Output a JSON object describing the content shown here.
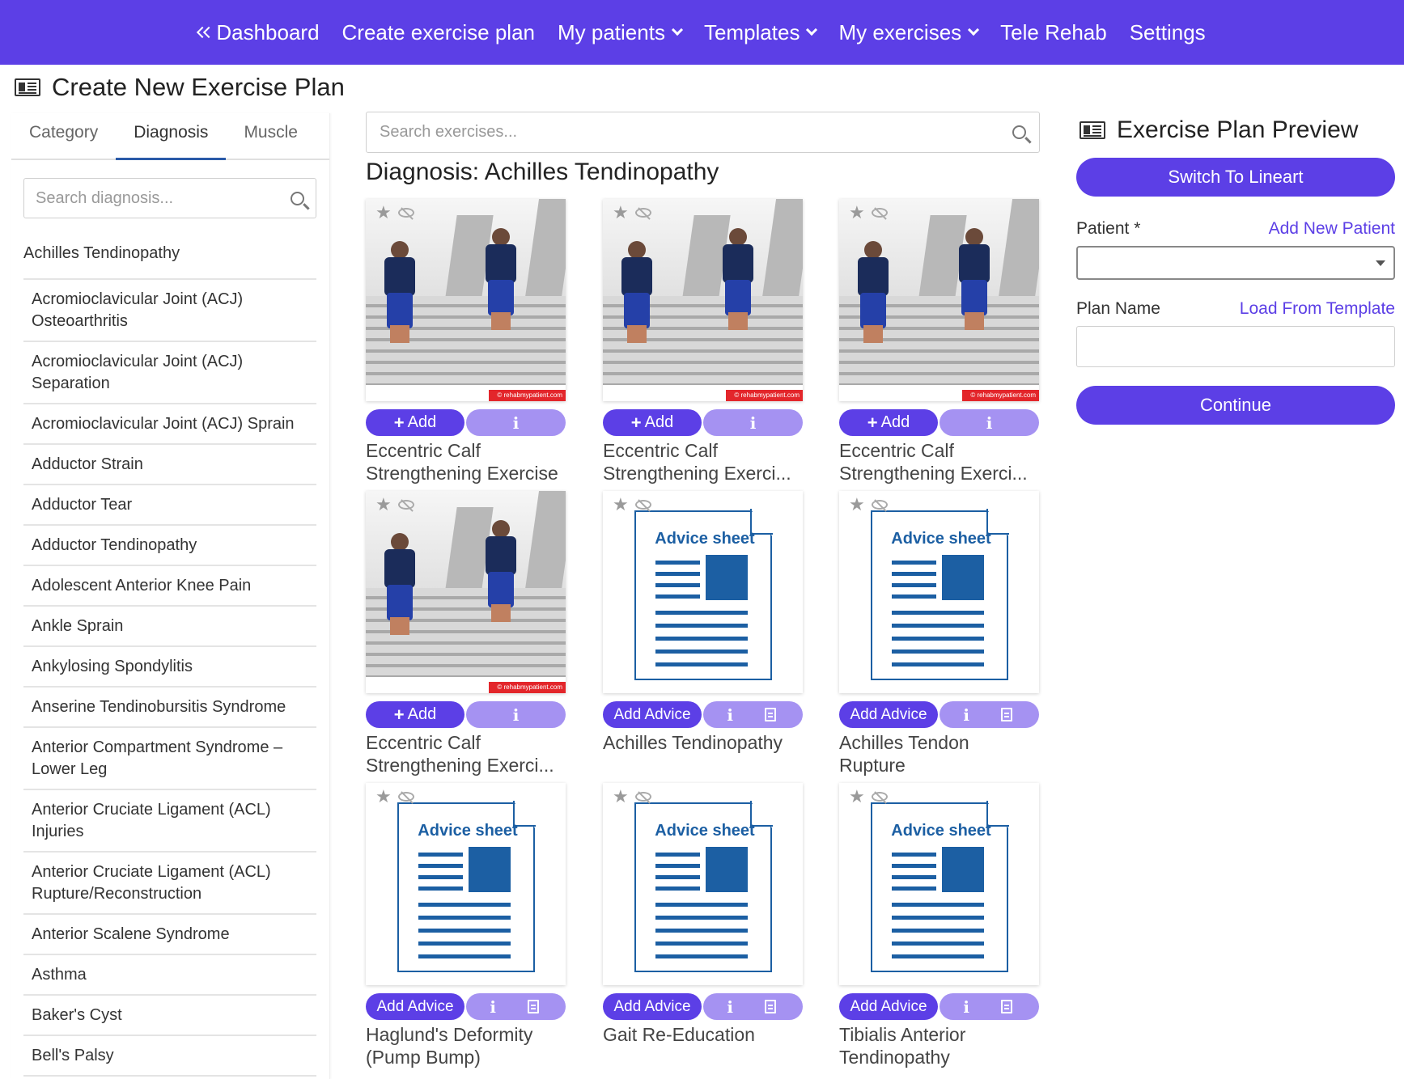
{
  "nav": {
    "dashboard": "Dashboard",
    "create_plan": "Create exercise plan",
    "my_patients": "My patients",
    "templates": "Templates",
    "my_exercises": "My exercises",
    "tele_rehab": "Tele Rehab",
    "settings": "Settings"
  },
  "page_title": "Create New Exercise Plan",
  "left": {
    "tabs": [
      "Category",
      "Diagnosis",
      "Muscle"
    ],
    "active_tab": "Diagnosis",
    "search_placeholder": "Search diagnosis...",
    "selected": "Achilles Tendinopathy",
    "items": [
      "Acromioclavicular Joint (ACJ) Osteoarthritis",
      "Acromioclavicular Joint (ACJ) Separation",
      "Acromioclavicular Joint (ACJ) Sprain",
      "Adductor Strain",
      "Adductor Tear",
      "Adductor Tendinopathy",
      "Adolescent Anterior Knee Pain",
      "Ankle Sprain",
      "Ankylosing Spondylitis",
      "Anserine Tendinobursitis Syndrome",
      "Anterior Compartment Syndrome – Lower Leg",
      "Anterior Cruciate Ligament (ACL) Injuries",
      "Anterior Cruciate Ligament (ACL) Rupture/Reconstruction",
      "Anterior Scalene Syndrome",
      "Asthma",
      "Baker's Cyst",
      "Bell's Palsy"
    ]
  },
  "main": {
    "search_placeholder": "Search exercises...",
    "section_title": "Diagnosis: Achilles Tendinopathy",
    "add_label": "Add",
    "add_advice_label": "Add Advice",
    "info_glyph": "i",
    "advice_sheet_title": "Advice sheet",
    "watermark": "© rehabmypatient.com",
    "cards": [
      {
        "name": "Eccentric Calf Strengthening Exercise",
        "kind": "exercise"
      },
      {
        "name": "Eccentric Calf Strengthening Exerci...",
        "kind": "exercise"
      },
      {
        "name": "Eccentric Calf Strengthening Exerci...",
        "kind": "exercise"
      },
      {
        "name": "Eccentric Calf Strengthening Exerci...",
        "kind": "exercise"
      },
      {
        "name": "Achilles Tendinopathy",
        "kind": "advice"
      },
      {
        "name": "Achilles Tendon Rupture",
        "kind": "advice"
      },
      {
        "name": "Haglund's Deformity (Pump Bump)",
        "kind": "advice"
      },
      {
        "name": "Gait Re-Education",
        "kind": "advice"
      },
      {
        "name": "Tibialis Anterior Tendinopathy",
        "kind": "advice"
      }
    ]
  },
  "right": {
    "title": "Exercise Plan Preview",
    "switch_button": "Switch To Lineart",
    "patient_label": "Patient *",
    "add_patient_link": "Add New Patient",
    "patient_value": "",
    "plan_name_label": "Plan Name",
    "load_template_link": "Load From Template",
    "plan_name_value": "",
    "continue_button": "Continue"
  },
  "colors": {
    "brand": "#5c3fe6",
    "brand_light": "#a592f2",
    "advice_blue": "#1c5fa3"
  }
}
